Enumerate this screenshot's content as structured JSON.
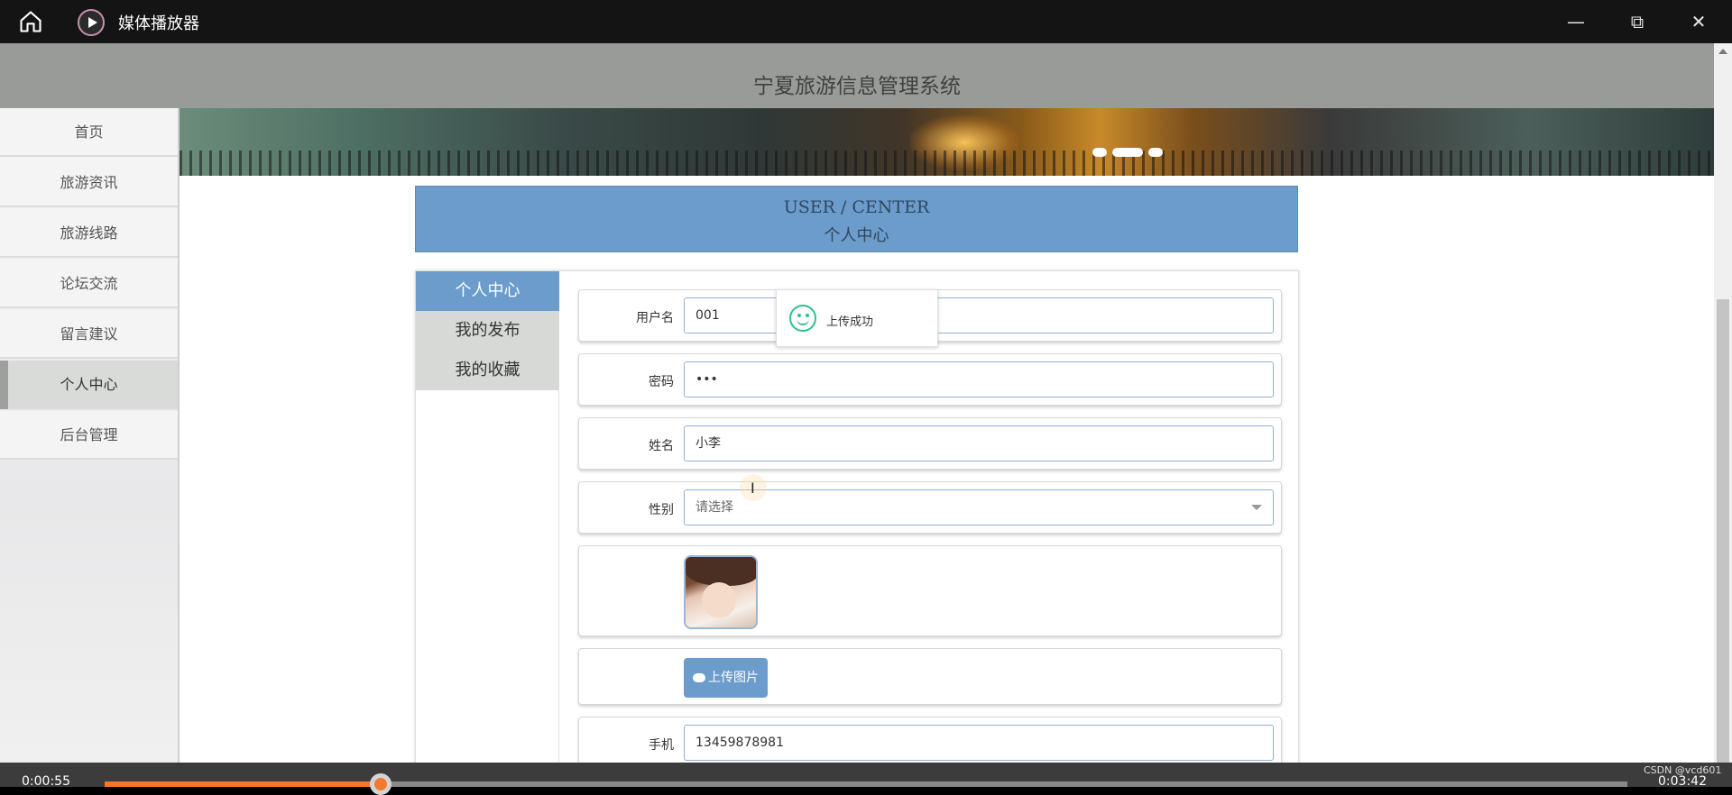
{
  "player": {
    "title": "媒体播放器",
    "minimize_icon": "minimize-icon",
    "maximize_icon": "restore-icon",
    "close_icon": "close-icon",
    "current_time": "0:00:55",
    "total_time": "0:03:42",
    "progress": 0.181,
    "watermark": "CSDN @vcd601"
  },
  "site": {
    "title": "宁夏旅游信息管理系统"
  },
  "nav": {
    "items": [
      {
        "label": "首页"
      },
      {
        "label": "旅游资讯"
      },
      {
        "label": "旅游线路"
      },
      {
        "label": "论坛交流"
      },
      {
        "label": "留言建议"
      },
      {
        "label": "个人中心"
      },
      {
        "label": "后台管理"
      }
    ],
    "active_index": 5
  },
  "banner": {
    "slide_count": 3,
    "active_slide": 2
  },
  "user_center": {
    "title_en": "USER / CENTER",
    "title_cn": "个人中心"
  },
  "side_menu": {
    "items": [
      {
        "label": "个人中心"
      },
      {
        "label": "我的发布"
      },
      {
        "label": "我的收藏"
      }
    ],
    "active_index": 0
  },
  "form": {
    "username": {
      "label": "用户名",
      "value": "001"
    },
    "password": {
      "label": "密码",
      "value": "•••"
    },
    "name": {
      "label": "姓名",
      "value": "小李"
    },
    "gender": {
      "label": "性别",
      "placeholder": "请选择"
    },
    "upload_button": "上传图片",
    "phone": {
      "label": "手机",
      "value": "13459878981"
    }
  },
  "toast": {
    "message": "上传成功",
    "icon": "smile-icon"
  },
  "colors": {
    "accent": "#6b9ccc",
    "progress": "#f27a30",
    "success": "#2fc08a"
  }
}
